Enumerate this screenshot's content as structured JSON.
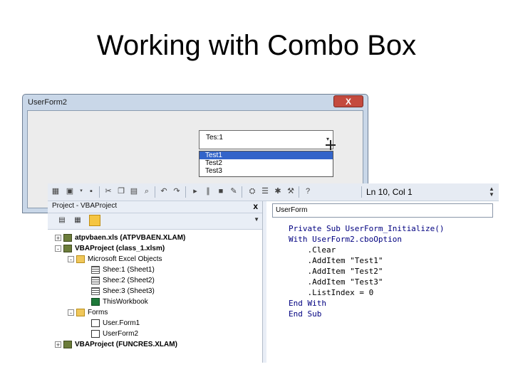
{
  "slide": {
    "title": "Working with Combo Box"
  },
  "userform": {
    "title": "UserForm2",
    "close_label": "X",
    "combo": {
      "value": "Tes:1",
      "options": [
        "Test1",
        "Test2",
        "Test3"
      ],
      "selected_index": 0
    }
  },
  "vbe": {
    "toolbar": {
      "position_text": "Ln 10, Col 1"
    },
    "project_panel": {
      "title": "Project - VBAProject",
      "close_label": "x",
      "tree": [
        {
          "label": "atpvbaen.xls (ATPVBAEN.XLAM)",
          "bold": true,
          "level": 0,
          "icon": "vba-project-icon",
          "expander": "+"
        },
        {
          "label": "VBAProject (class_1.xlsm)",
          "bold": true,
          "level": 0,
          "icon": "vba-project-icon",
          "expander": "-"
        },
        {
          "label": "Microsoft Excel Objects",
          "bold": false,
          "level": 1,
          "icon": "folder-icon",
          "expander": "-"
        },
        {
          "label": "Shee:1 (Sheet1)",
          "bold": false,
          "level": 2,
          "icon": "sheet-icon",
          "expander": ""
        },
        {
          "label": "Shee:2 (Sheet2)",
          "bold": false,
          "level": 2,
          "icon": "sheet-icon",
          "expander": ""
        },
        {
          "label": "Shee:3 (Sheet3)",
          "bold": false,
          "level": 2,
          "icon": "sheet-icon",
          "expander": ""
        },
        {
          "label": "ThisWorkbook",
          "bold": false,
          "level": 2,
          "icon": "workbook-icon",
          "expander": ""
        },
        {
          "label": "Forms",
          "bold": false,
          "level": 1,
          "icon": "folder-icon",
          "expander": "-"
        },
        {
          "label": "User.Form1",
          "bold": false,
          "level": 2,
          "icon": "form-icon",
          "expander": ""
        },
        {
          "label": "UserForm2",
          "bold": false,
          "level": 2,
          "icon": "form-icon",
          "expander": ""
        },
        {
          "label": "VBAProject (FUNCRES.XLAM)",
          "bold": true,
          "level": 0,
          "icon": "vba-project-icon",
          "expander": "+"
        }
      ]
    },
    "code_panel": {
      "object_combo": "UserForm",
      "lines": [
        "Private Sub UserForm_Initialize()",
        "With UserForm2.cboOption",
        "    .Clear",
        "    .AddItem \"Test1\"",
        "    .AddItem \"Test2\"",
        "    .AddItem \"Test3\"",
        "    .ListIndex = 0",
        "End With",
        "End Sub"
      ]
    }
  },
  "colors": {
    "selection": "#3364c9",
    "window_frame": "#c9d7e8",
    "close_button": "#c44a3e"
  }
}
